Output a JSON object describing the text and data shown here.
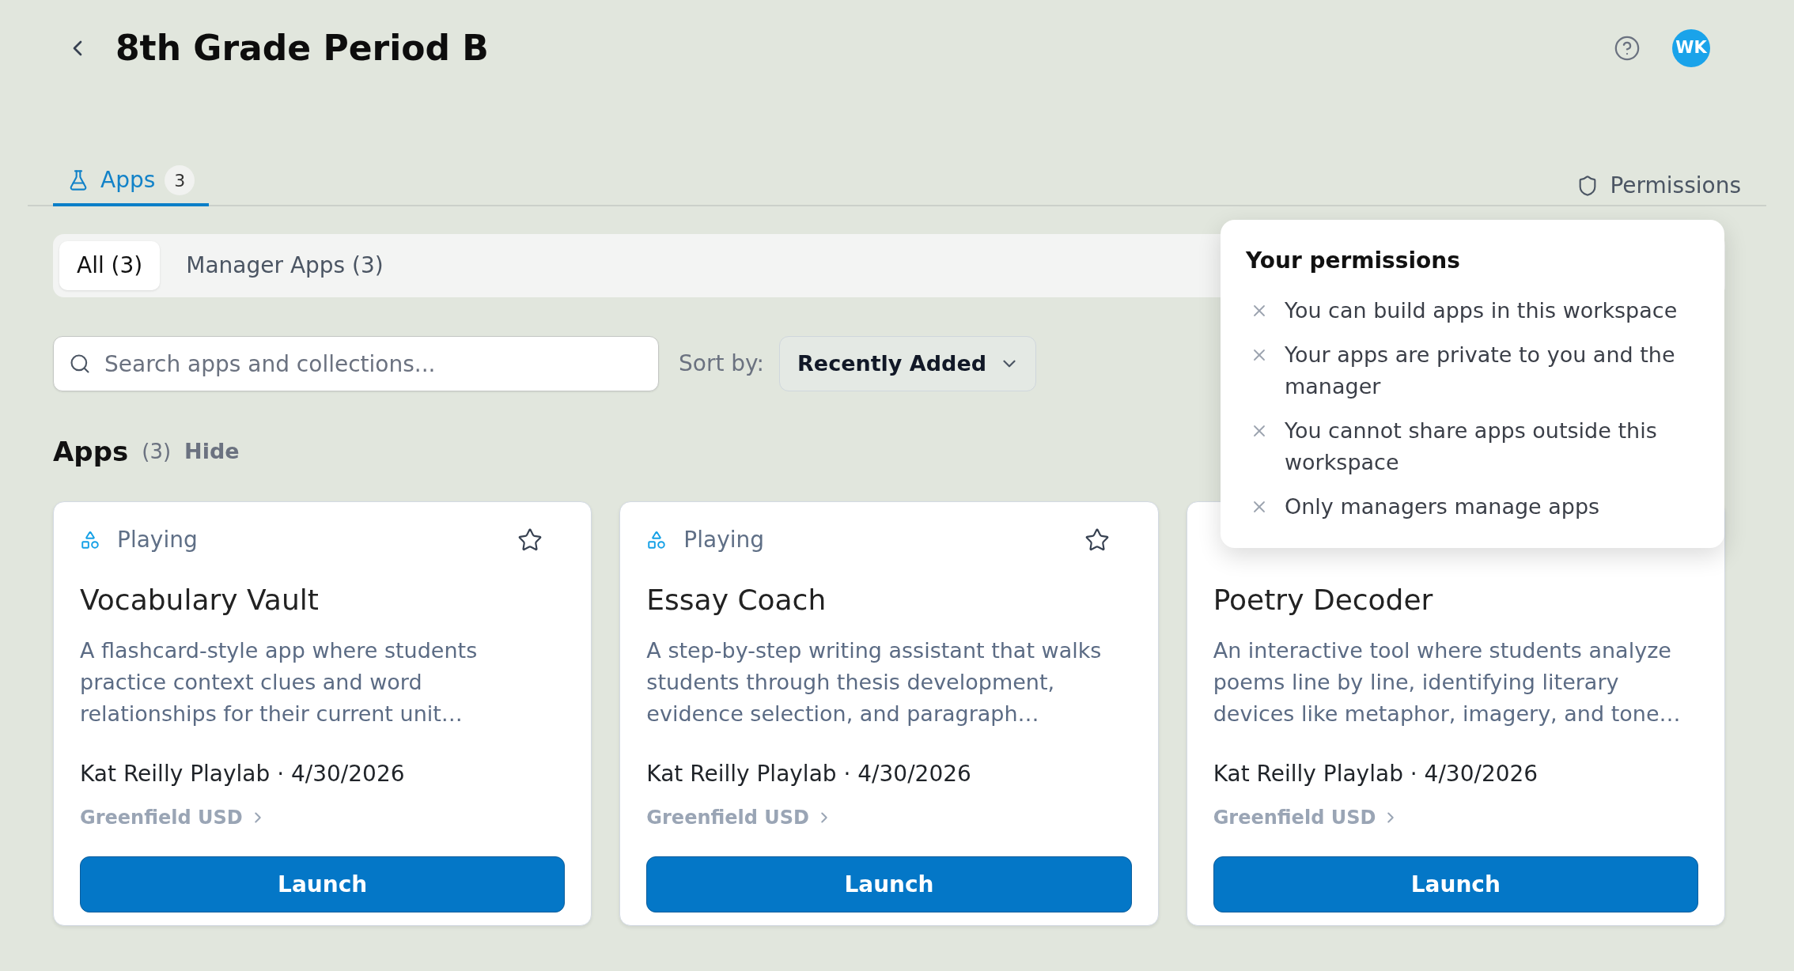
{
  "header": {
    "title": "8th Grade Period B",
    "avatar": "WK"
  },
  "tabs": [
    {
      "label": "Apps",
      "count": "3",
      "selected": true
    }
  ],
  "permissions_button": {
    "label": "Permissions"
  },
  "filters": [
    {
      "label": "All (3)",
      "selected": true
    },
    {
      "label": "Manager Apps (3)",
      "selected": false
    }
  ],
  "search": {
    "placeholder": "Search apps and collections..."
  },
  "sort": {
    "label": "Sort by:",
    "value": "Recently Added"
  },
  "section": {
    "title": "Apps",
    "count": "(3)",
    "toggle": "Hide"
  },
  "cards": [
    {
      "status": "Playing",
      "starred": false,
      "title": "Vocabulary Vault",
      "description": "A flashcard-style app where students practice context clues and word relationships for their current unit…",
      "meta": "Kat Reilly Playlab · 4/30/2026",
      "organization": "Greenfield USD",
      "button": "Launch"
    },
    {
      "status": "Playing",
      "starred": false,
      "title": "Essay Coach",
      "description": "A step-by-step writing assistant that walks students through thesis development, evidence selection, and paragraph…",
      "meta": "Kat Reilly Playlab · 4/30/2026",
      "organization": "Greenfield USD",
      "button": "Launch"
    },
    {
      "title": "Poetry Decoder",
      "description": "An interactive tool where students analyze poems line by line, identifying literary devices like metaphor, imagery, and tone…",
      "meta": "Kat Reilly Playlab · 4/30/2026",
      "organization": "Greenfield USD",
      "button": "Launch"
    }
  ],
  "permissions_popover": {
    "title": "Your permissions",
    "items": [
      {
        "text": "You can build apps in this workspace",
        "allowed": false
      },
      {
        "text": "Your apps are private to you and the manager",
        "allowed": false
      },
      {
        "text": "You cannot share apps outside this workspace",
        "allowed": false
      },
      {
        "text": "Only managers manage apps",
        "allowed": false
      }
    ]
  }
}
